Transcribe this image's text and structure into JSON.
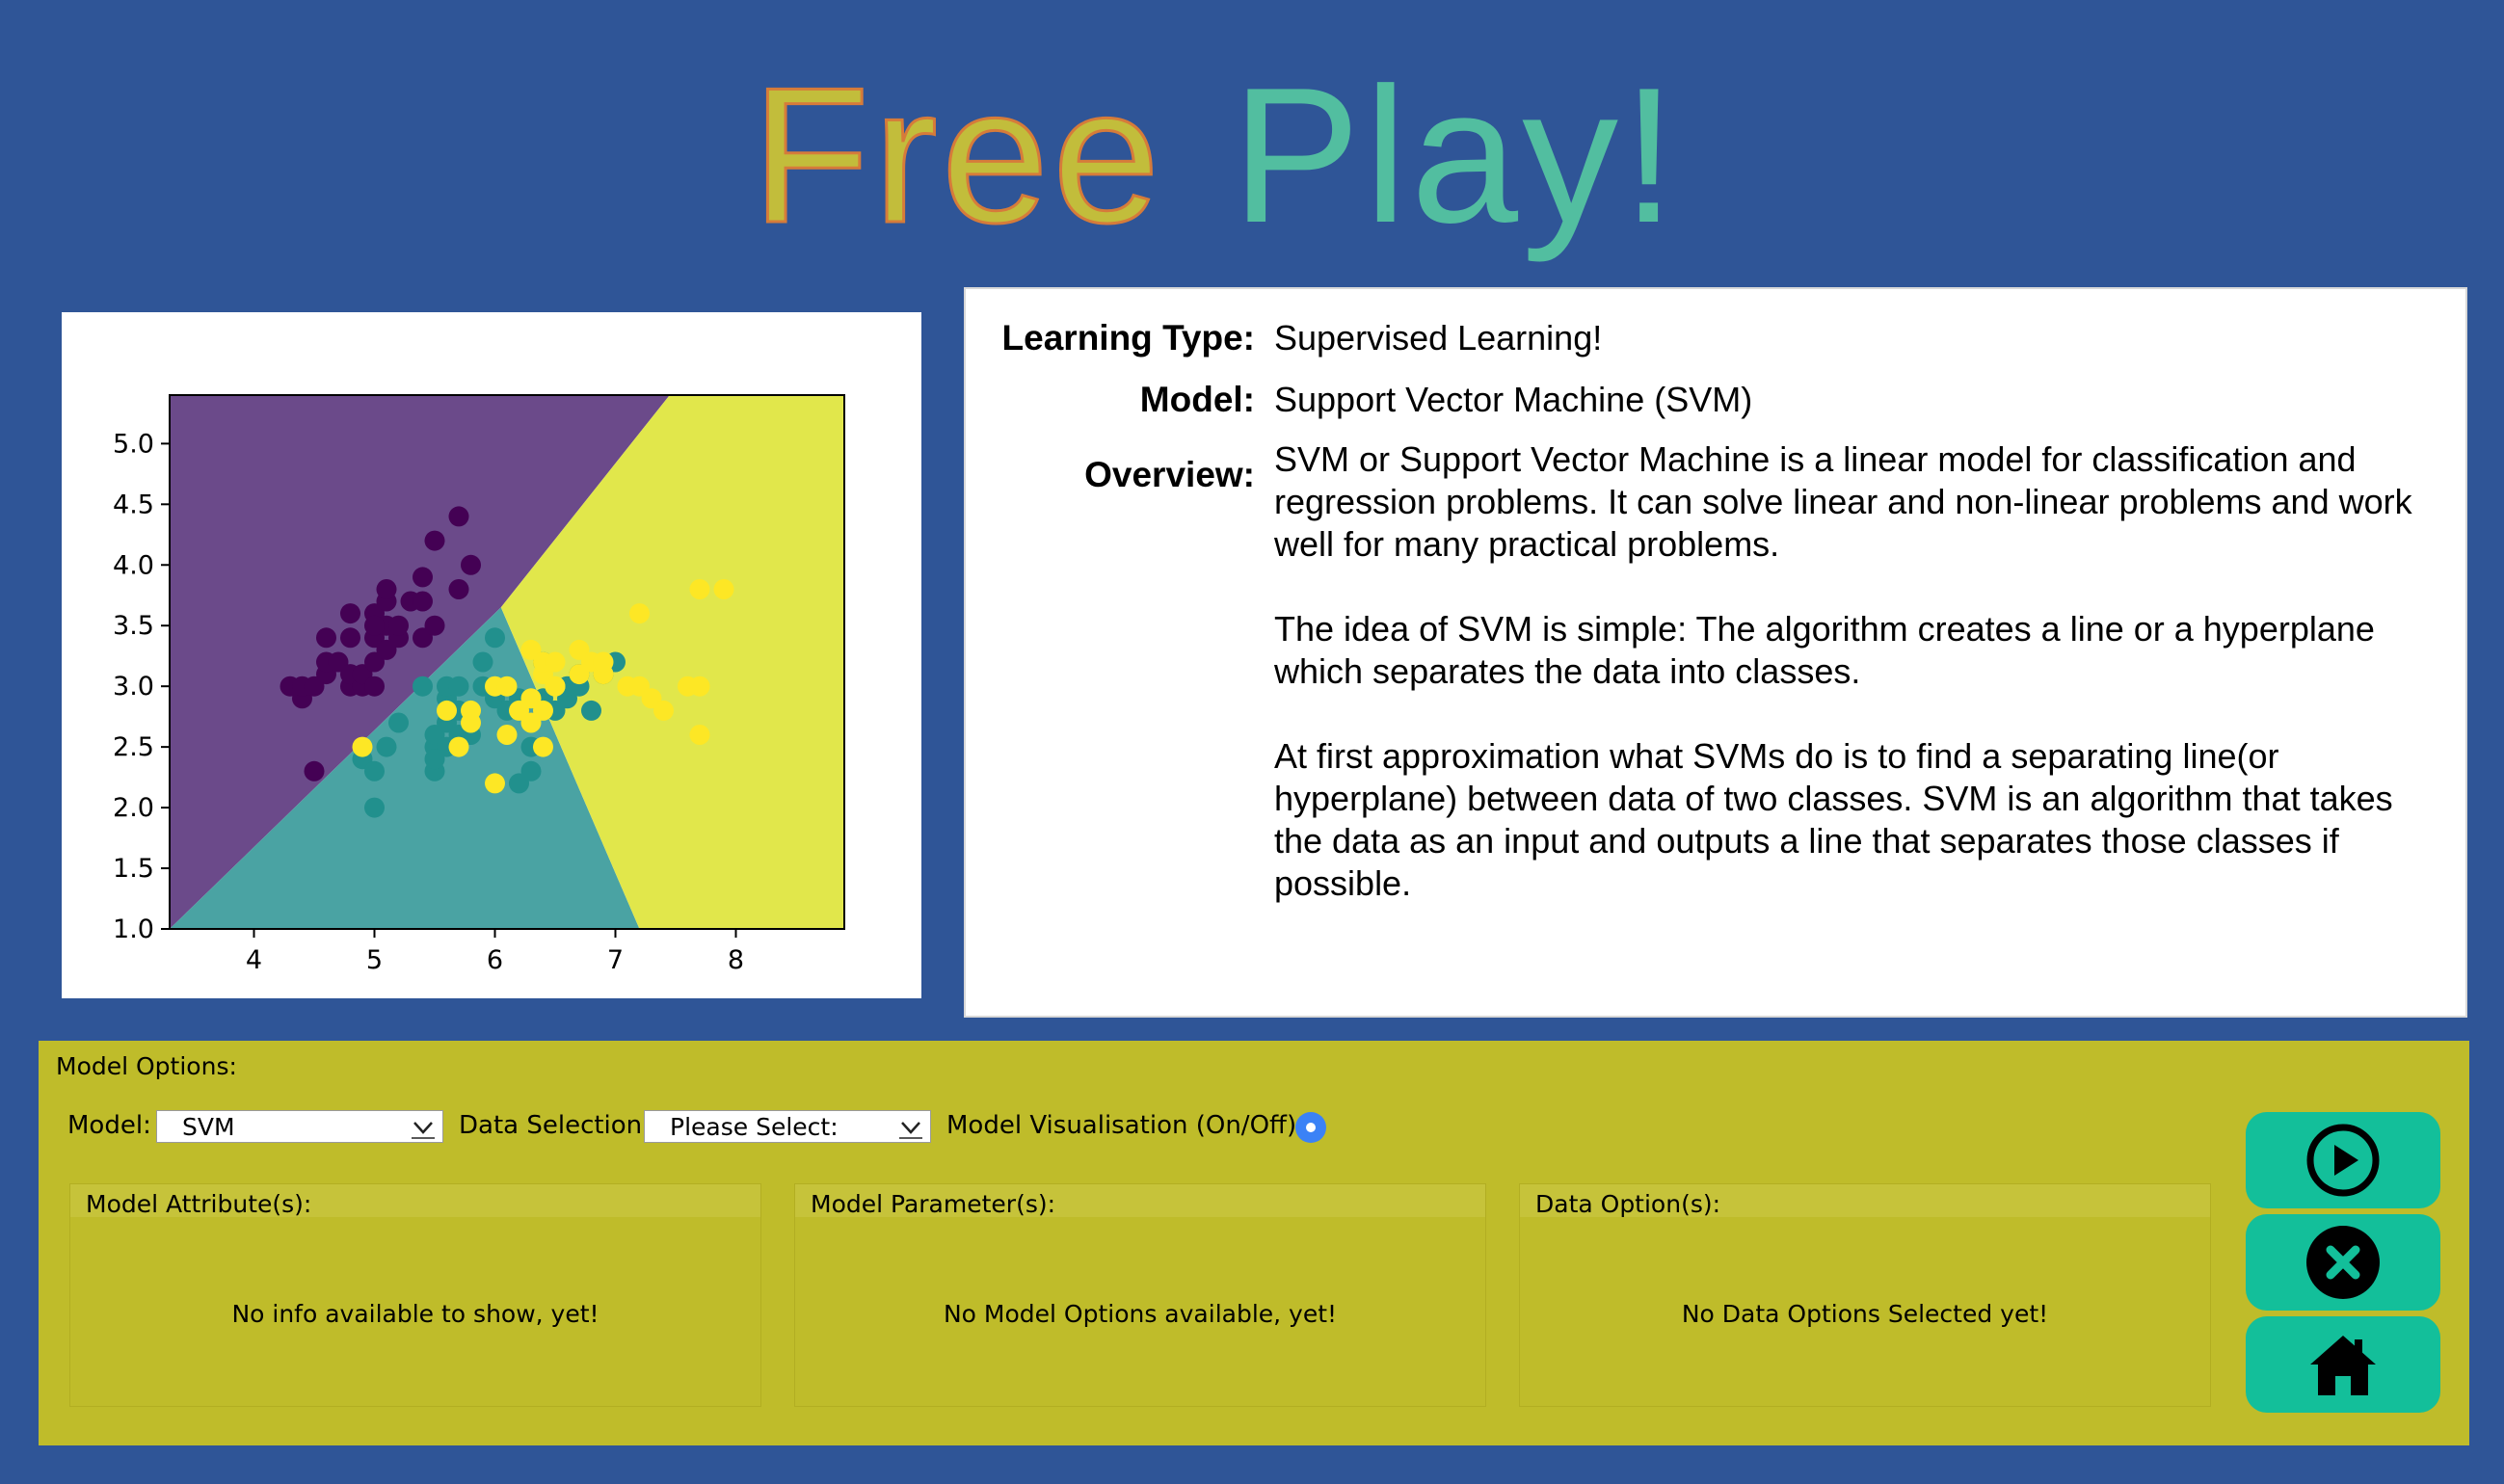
{
  "header": {
    "title_word1": "Free",
    "title_word2": "Play!",
    "color_word1": "#c2bd3b",
    "color_word2": "#52bea0"
  },
  "chart_data": {
    "type": "scatter",
    "title": "",
    "xlabel": "",
    "ylabel": "",
    "xlim": [
      3.3,
      8.9
    ],
    "ylim": [
      1.0,
      5.4
    ],
    "x_ticks": [
      "4",
      "5",
      "6",
      "7",
      "8"
    ],
    "y_ticks": [
      "1.0",
      "1.5",
      "2.0",
      "2.5",
      "3.0",
      "3.5",
      "4.0",
      "4.5",
      "5.0"
    ],
    "regions": [
      {
        "class": "0",
        "color": "#6b4a8a"
      },
      {
        "class": "1",
        "color": "#4aa3a3"
      },
      {
        "class": "2",
        "color": "#e1e74b"
      }
    ],
    "series": [
      {
        "class": "0",
        "color": "#440154",
        "x": [
          4.3,
          4.4,
          4.4,
          4.5,
          4.6,
          4.6,
          4.6,
          4.7,
          4.8,
          4.8,
          4.8,
          4.9,
          4.9,
          5.0,
          5.0,
          5.0,
          5.0,
          5.1,
          5.1,
          5.1,
          5.1,
          5.2,
          5.2,
          5.3,
          5.4,
          5.4,
          5.4,
          5.5,
          5.5,
          5.7,
          5.7,
          5.8,
          4.8,
          5.0,
          4.5
        ],
        "y": [
          3.0,
          2.9,
          3.0,
          2.3,
          3.1,
          3.2,
          3.4,
          3.2,
          3.0,
          3.1,
          3.4,
          3.0,
          3.1,
          3.0,
          3.2,
          3.4,
          3.6,
          3.3,
          3.5,
          3.7,
          3.8,
          3.4,
          3.5,
          3.7,
          3.4,
          3.7,
          3.9,
          3.5,
          4.2,
          3.8,
          4.4,
          4.0,
          3.6,
          3.5,
          3.0
        ]
      },
      {
        "class": "1",
        "color": "#21908d",
        "x": [
          4.9,
          5.0,
          5.0,
          5.1,
          5.2,
          5.4,
          5.5,
          5.5,
          5.5,
          5.6,
          5.6,
          5.6,
          5.7,
          5.7,
          5.7,
          5.8,
          5.8,
          5.9,
          5.9,
          6.0,
          6.0,
          6.0,
          6.1,
          6.1,
          6.2,
          6.2,
          6.3,
          6.3,
          6.4,
          6.4,
          6.5,
          6.6,
          6.6,
          6.7,
          6.7,
          6.8,
          6.9,
          7.0,
          5.6,
          5.5
        ],
        "y": [
          2.4,
          2.0,
          2.3,
          2.5,
          2.7,
          3.0,
          2.3,
          2.5,
          2.6,
          2.5,
          2.9,
          3.0,
          2.6,
          2.8,
          3.0,
          2.7,
          2.6,
          3.0,
          3.2,
          2.2,
          2.9,
          3.4,
          2.8,
          3.0,
          2.2,
          2.9,
          2.3,
          2.5,
          2.9,
          3.2,
          2.8,
          2.9,
          3.0,
          3.0,
          3.1,
          2.8,
          3.1,
          3.2,
          2.7,
          2.4
        ]
      },
      {
        "class": "2",
        "color": "#fde725",
        "x": [
          4.9,
          5.6,
          5.7,
          5.8,
          5.8,
          6.0,
          6.0,
          6.1,
          6.2,
          6.3,
          6.3,
          6.3,
          6.4,
          6.4,
          6.4,
          6.5,
          6.5,
          6.5,
          6.7,
          6.7,
          6.8,
          6.9,
          6.9,
          7.1,
          7.2,
          7.2,
          7.3,
          7.4,
          7.6,
          7.7,
          7.7,
          7.7,
          7.9,
          6.1,
          6.4
        ],
        "y": [
          2.5,
          2.8,
          2.5,
          2.7,
          2.8,
          2.2,
          3.0,
          3.0,
          2.8,
          2.7,
          2.9,
          3.3,
          2.8,
          3.1,
          3.2,
          3.0,
          3.2,
          3.0,
          3.1,
          3.3,
          3.2,
          3.1,
          3.2,
          3.0,
          3.0,
          3.6,
          2.9,
          2.8,
          3.0,
          2.6,
          3.0,
          3.8,
          3.8,
          2.6,
          2.5
        ]
      }
    ]
  },
  "info": {
    "learning_type_label": "Learning Type:",
    "learning_type_value": "Supervised Learning!",
    "model_label": "Model:",
    "model_value": "Support Vector Machine (SVM)",
    "overview_label": "Overview:",
    "overview_p1_lines": [
      "SVM or Support Vector Machine is a linear model for classification and",
      "regression problems. It can solve linear and non-linear problems and work",
      "well for many practical problems."
    ],
    "overview_p2_lines": [
      "The idea of SVM is simple: The algorithm creates a line or a hyperplane",
      "which separates the data into classes."
    ],
    "overview_p3_lines": [
      "At first approximation what SVMs do is to find a separating line(or",
      "hyperplane) between data of two classes. SVM is an algorithm that takes",
      "the data as an input and outputs a line that separates those classes if",
      "possible."
    ]
  },
  "options": {
    "panel_title": "Model Options:",
    "model_label": "Model:",
    "model_value": "SVM",
    "data_selection_label": "Data Selection:",
    "data_selection_value": "Please Select:",
    "visualisation_label": "Model Visualisation (On/Off):",
    "visualisation_on": true,
    "groups": [
      {
        "label": "Model Attribute(s):",
        "message": "No info available to show, yet!"
      },
      {
        "label": "Model Parameter(s):",
        "message": "No Model Options available, yet!"
      },
      {
        "label": "Data Option(s):",
        "message": "No Data Options Selected yet!"
      }
    ]
  },
  "actions": [
    {
      "icon": "play-circle-icon"
    },
    {
      "icon": "close-circle-icon"
    },
    {
      "icon": "home-icon"
    }
  ],
  "colors": {
    "background": "#2f5597",
    "options_panel": "#bfbc2a",
    "action_button": "#13bf9a",
    "radio": "#3b82f6"
  }
}
